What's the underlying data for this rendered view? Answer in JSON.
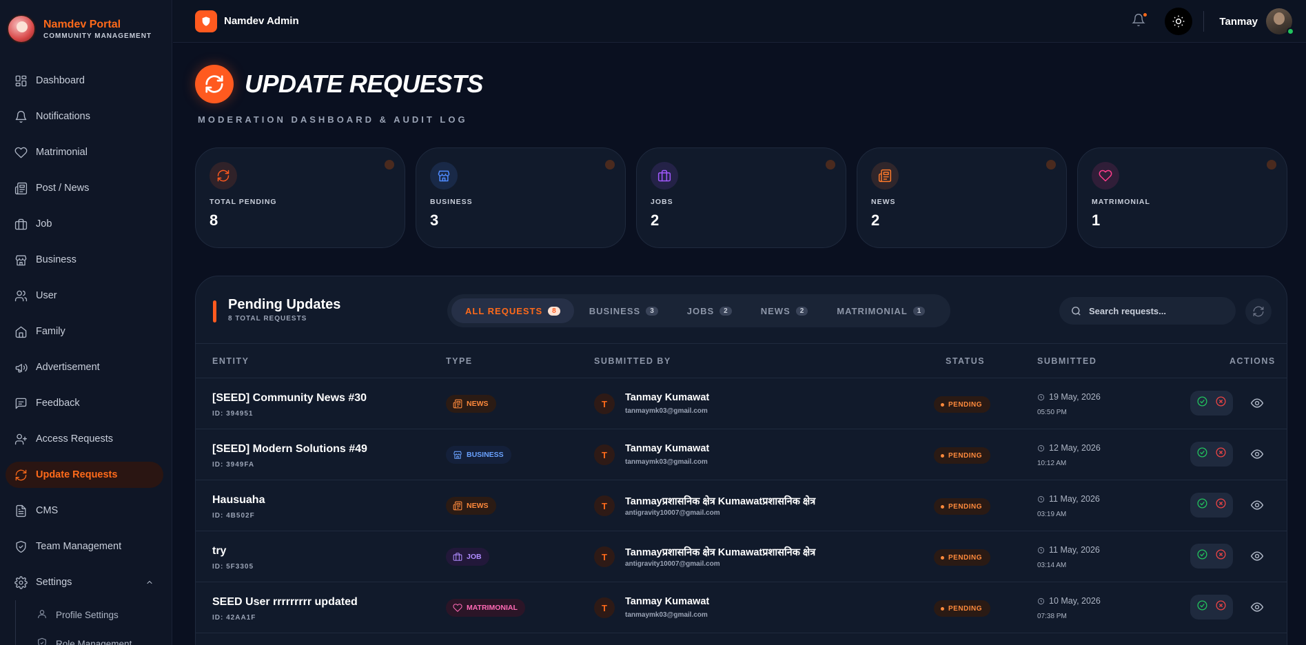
{
  "brand": {
    "title": "Namdev Portal",
    "subtitle": "COMMUNITY MANAGEMENT"
  },
  "sidebar": {
    "items": [
      {
        "label": "Dashboard",
        "icon": "grid-icon"
      },
      {
        "label": "Notifications",
        "icon": "bell-icon"
      },
      {
        "label": "Matrimonial",
        "icon": "heart-icon"
      },
      {
        "label": "Post / News",
        "icon": "newspaper-icon"
      },
      {
        "label": "Job",
        "icon": "briefcase-icon"
      },
      {
        "label": "Business",
        "icon": "store-icon"
      },
      {
        "label": "User",
        "icon": "users-icon"
      },
      {
        "label": "Family",
        "icon": "home-icon"
      },
      {
        "label": "Advertisement",
        "icon": "megaphone-icon"
      },
      {
        "label": "Feedback",
        "icon": "message-icon"
      },
      {
        "label": "Access Requests",
        "icon": "user-plus-icon"
      },
      {
        "label": "Update Requests",
        "icon": "refresh-icon",
        "active": true
      },
      {
        "label": "CMS",
        "icon": "document-icon"
      },
      {
        "label": "Team Management",
        "icon": "shield-icon"
      },
      {
        "label": "Settings",
        "icon": "gear-icon",
        "expanded": true
      }
    ],
    "sub_items": [
      {
        "label": "Profile Settings",
        "icon": "user-icon"
      },
      {
        "label": "Role Management",
        "icon": "shield-icon"
      }
    ]
  },
  "topbar": {
    "app_name": "Namdev Admin",
    "user_name": "Tanmay"
  },
  "header": {
    "title": "UPDATE REQUESTS",
    "subtitle": "MODERATION DASHBOARD & AUDIT LOG"
  },
  "stats": [
    {
      "label": "TOTAL PENDING",
      "value": "8",
      "icon": "refresh-icon",
      "color": "#ff5a1f"
    },
    {
      "label": "BUSINESS",
      "value": "3",
      "icon": "store-icon",
      "color": "#4f8bff"
    },
    {
      "label": "JOBS",
      "value": "2",
      "icon": "briefcase-icon",
      "color": "#a259ff"
    },
    {
      "label": "NEWS",
      "value": "2",
      "icon": "newspaper-icon",
      "color": "#ff7a2a"
    },
    {
      "label": "MATRIMONIAL",
      "value": "1",
      "icon": "heart-icon",
      "color": "#ff3d8b"
    }
  ],
  "panel": {
    "title": "Pending Updates",
    "subtitle": "8 TOTAL REQUESTS",
    "tabs": [
      {
        "label": "ALL REQUESTS",
        "count": "8",
        "active": true
      },
      {
        "label": "BUSINESS",
        "count": "3"
      },
      {
        "label": "JOBS",
        "count": "2"
      },
      {
        "label": "NEWS",
        "count": "2"
      },
      {
        "label": "MATRIMONIAL",
        "count": "1"
      }
    ],
    "search_placeholder": "Search requests...",
    "columns": {
      "entity": "ENTITY",
      "type": "TYPE",
      "submitted_by": "SUBMITTED BY",
      "status": "STATUS",
      "submitted": "SUBMITTED",
      "actions": "ACTIONS"
    },
    "rows": [
      {
        "entity": "[SEED] Community News #30",
        "id": "ID: 394951",
        "type": "NEWS",
        "type_key": "news",
        "initial": "T",
        "name": "Tanmay Kumawat",
        "email": "tanmaymk03@gmail.com",
        "status": "PENDING",
        "date": "19 May, 2026",
        "time": "05:50 PM"
      },
      {
        "entity": "[SEED] Modern Solutions #49",
        "id": "ID: 3949FA",
        "type": "BUSINESS",
        "type_key": "business",
        "initial": "T",
        "name": "Tanmay Kumawat",
        "email": "tanmaymk03@gmail.com",
        "status": "PENDING",
        "date": "12 May, 2026",
        "time": "10:12 AM"
      },
      {
        "entity": "Hausuaha",
        "id": "ID: 4B502F",
        "type": "NEWS",
        "type_key": "news",
        "initial": "T",
        "name": "Tanmayप्रशासनिक क्षेत्र Kumawatप्रशासनिक क्षेत्र",
        "email": "antigravity10007@gmail.com",
        "status": "PENDING",
        "date": "11 May, 2026",
        "time": "03:19 AM"
      },
      {
        "entity": "try",
        "id": "ID: 5F3305",
        "type": "JOB",
        "type_key": "job",
        "initial": "T",
        "name": "Tanmayप्रशासनिक क्षेत्र Kumawatप्रशासनिक क्षेत्र",
        "email": "antigravity10007@gmail.com",
        "status": "PENDING",
        "date": "11 May, 2026",
        "time": "03:14 AM"
      },
      {
        "entity": "SEED User rrrrrrrrr updated",
        "id": "ID: 42AA1F",
        "type": "MATRIMONIAL",
        "type_key": "matrimonial",
        "initial": "T",
        "name": "Tanmay Kumawat",
        "email": "tanmaymk03@gmail.com",
        "status": "PENDING",
        "date": "10 May, 2026",
        "time": "07:38 PM"
      }
    ]
  }
}
